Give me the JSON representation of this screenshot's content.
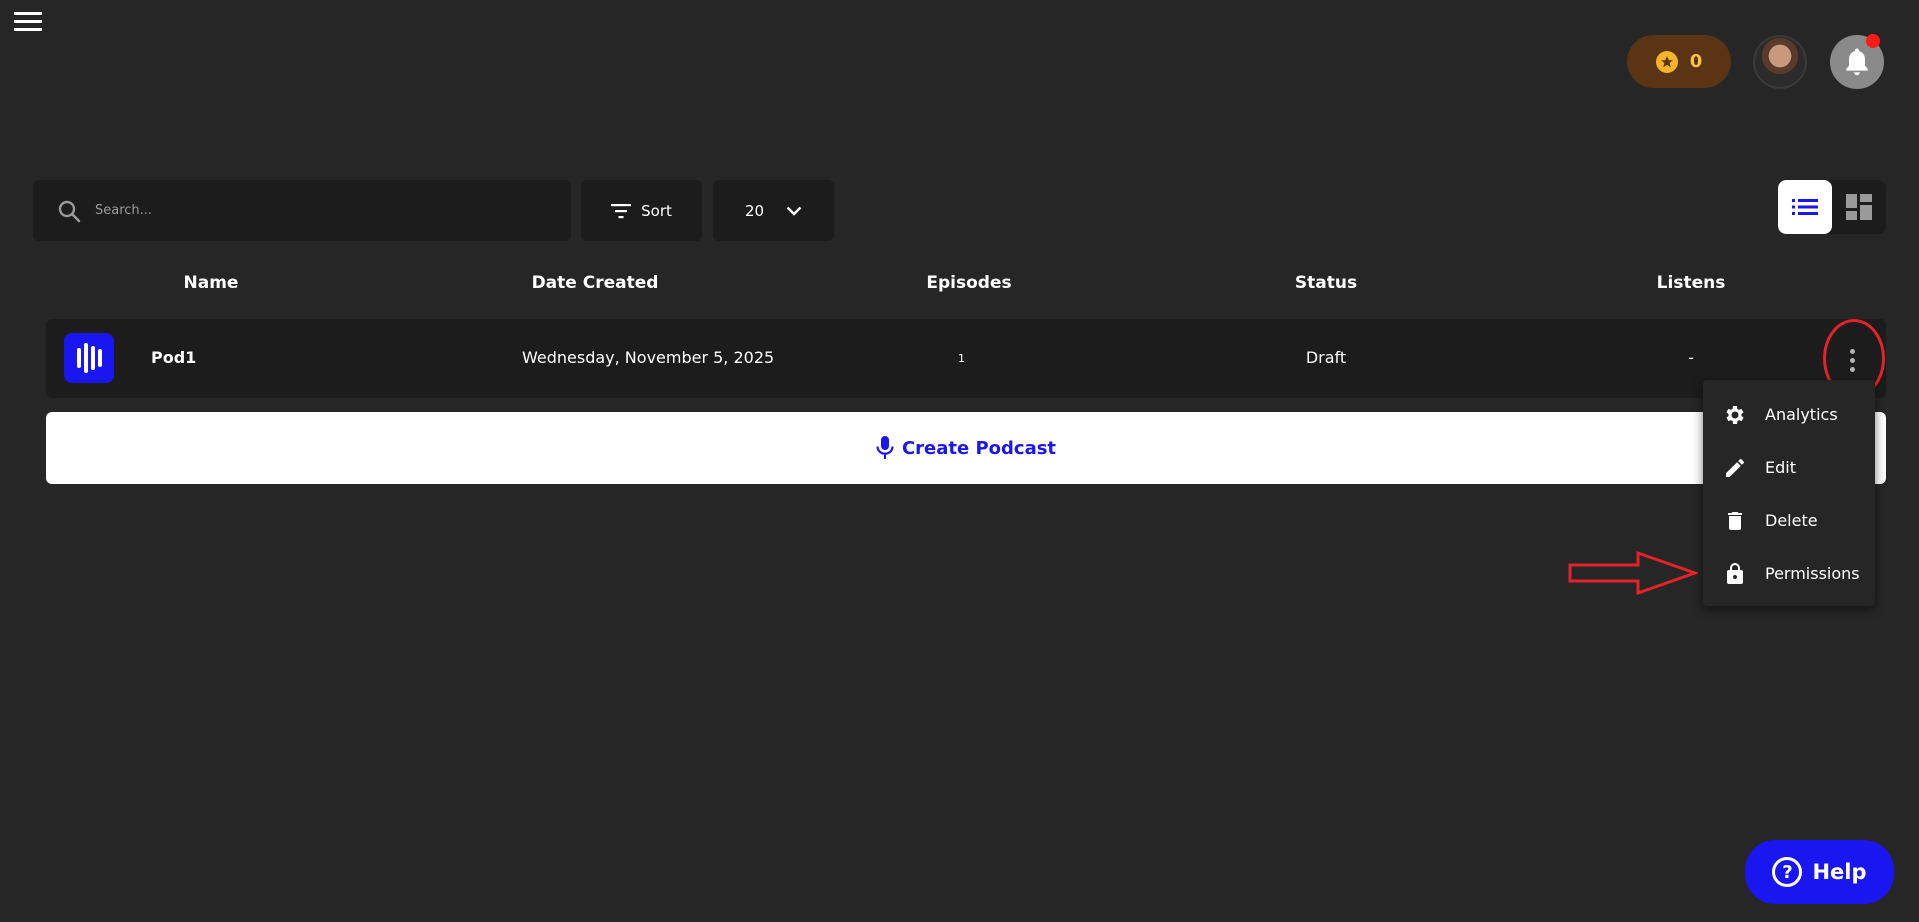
{
  "header": {
    "points_value": "0",
    "icons": {
      "menu": "hamburger-menu-icon",
      "coin": "star-coin-icon",
      "notifications": "bell-icon"
    },
    "notification_dot_color": "#ff1a1a"
  },
  "toolbar": {
    "search_placeholder": "Search...",
    "sort_label": "Sort",
    "page_size": "20"
  },
  "table": {
    "columns": [
      "Name",
      "Date Created",
      "Episodes",
      "Status",
      "Listens"
    ],
    "rows": [
      {
        "name": "Pod1",
        "date_created": "Wednesday, November 5, 2025",
        "episodes": "1",
        "status": "Draft",
        "listens": "-"
      }
    ]
  },
  "create_label": "Create Podcast",
  "row_menu": {
    "items": [
      {
        "label": "Analytics",
        "icon": "gear-icon"
      },
      {
        "label": "Edit",
        "icon": "pencil-icon"
      },
      {
        "label": "Delete",
        "icon": "trash-icon"
      },
      {
        "label": "Permissions",
        "icon": "lock-icon"
      }
    ]
  },
  "help_label": "Help",
  "colors": {
    "background": "#262626",
    "panel": "#1c1c1c",
    "accent_blue": "#1a16f0",
    "annotation_red": "#e3222a",
    "points_pill": "#5a3414",
    "points_text": "#f6c343"
  }
}
